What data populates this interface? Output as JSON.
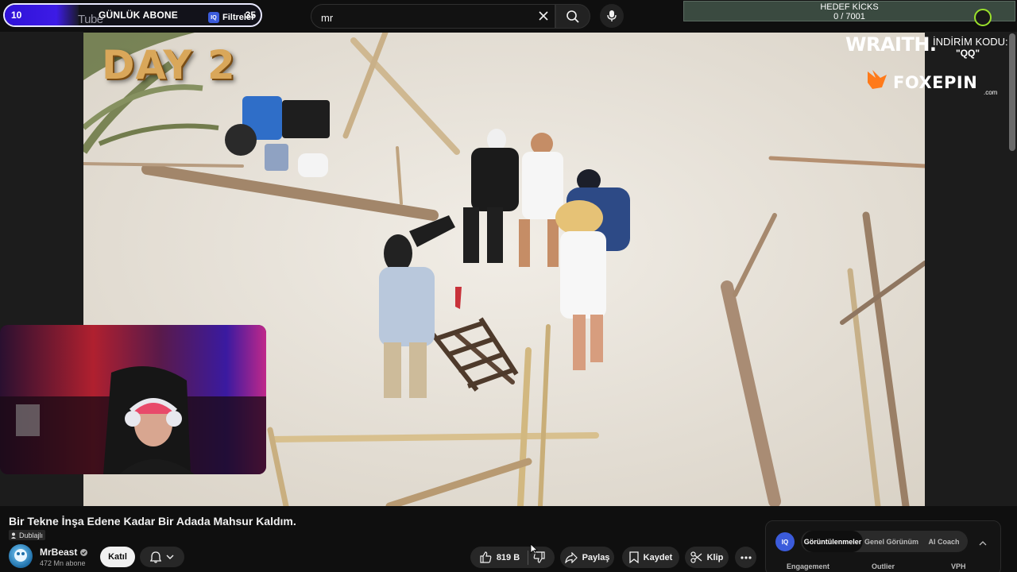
{
  "subscriber_goal": {
    "count": "10",
    "title": "GÜNLÜK ABONE",
    "goal": "35",
    "progress": 0.29,
    "ghost_logo_text": "Tube",
    "filter_label": "Filtreler"
  },
  "search": {
    "value": "mr"
  },
  "kicks_goal": {
    "title": "HEDEF KİCKS",
    "count": "0 / 7001"
  },
  "video": {
    "day_label": "DAY 2",
    "sponsor_brand": "WRAITH.",
    "sponsor_code_label": "İNDİRİM KODU:",
    "sponsor_code": "\"QQ\"",
    "sponsor2_brand": "FOXEPIN",
    "sponsor2_domain": ".com"
  },
  "title": {
    "text": "Bir Tekne İnşa Edene Kadar Bir Adada Mahsur Kaldım.",
    "dub_badge": "Dublajlı"
  },
  "channel": {
    "name": "MrBeast",
    "subscribers": "472 Mn abone",
    "join_label": "Katıl"
  },
  "actions": {
    "likes": "819 B",
    "share": "Paylaş",
    "save": "Kaydet",
    "clip": "Klip"
  },
  "iq_panel": {
    "logo": "IQ",
    "tabs": [
      "Görüntülenmeler",
      "Genel Görünüm",
      "AI Coach"
    ],
    "active_tab": 0,
    "columns": [
      "Engagement",
      "Outlier",
      "VPH"
    ]
  },
  "colors": {
    "subscriber_fill": "#3d1be6",
    "kicks_bg": "#3a4a40",
    "iq_accent": "#3b5bdb",
    "day_label": "#d9a75a"
  }
}
